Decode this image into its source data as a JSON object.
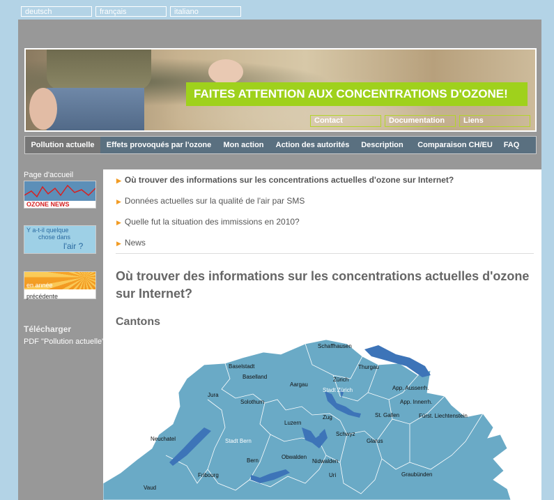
{
  "languages": [
    "deutsch",
    "français",
    "italiano"
  ],
  "banner": {
    "slogan": "FAITES ATTENTION AUX CONCENTRATIONS D'OZONE!",
    "links": [
      "Contact",
      "Documentation",
      "Liens"
    ]
  },
  "nav": [
    "Pollution actuelle",
    "Effets provoqués par l'ozone",
    "Mon action",
    "Action des autorités",
    "Description",
    "Comparaison CH/EU",
    "FAQ"
  ],
  "sidebar": {
    "home": "Page d'accueil",
    "ozone_news": "OZONE NEWS",
    "air_question": [
      "Y a-t-il quelque",
      "chose dans",
      "l'air ?"
    ],
    "prev_year": [
      "en année",
      "précédente"
    ],
    "download_title": "Télécharger",
    "download_link": "PDF \"Pollution actuelle\""
  },
  "links": [
    "Où trouver des informations sur les concentrations actuelles d'ozone sur Internet?",
    "Données actuelles sur la qualité de l'air par SMS",
    "Quelle fut la situation des immissions en 2010?",
    "News"
  ],
  "heading": "Où trouver des informations sur les concentrations actuelles d'ozone sur Internet?",
  "subheading": "Cantons",
  "map_labels": [
    "Schaffhausen",
    "Baselstadt",
    "Thurgau",
    "Baselland",
    "Aargau",
    "Zürich",
    "Jura",
    "Stadt Zürich",
    "App. Ausserrh.",
    "App. Innerrh.",
    "Solothurn",
    "Fürst. Liechtenstein",
    "St. Gallen",
    "Zug",
    "Luzern",
    "Schwyz",
    "Neuchatel",
    "Stadt Bern",
    "Glarus",
    "Bern",
    "Obwalden",
    "Nidwalden",
    "Fribourg",
    "Uri",
    "Graubünden",
    "Vaud"
  ],
  "colors": {
    "background": "#b3d3e6",
    "page": "#989898",
    "nav": "#5a7080",
    "accent_green": "#9fd11c",
    "canton": "#6aaac6",
    "lake": "#3d74b8",
    "bullet": "#f29c24"
  }
}
